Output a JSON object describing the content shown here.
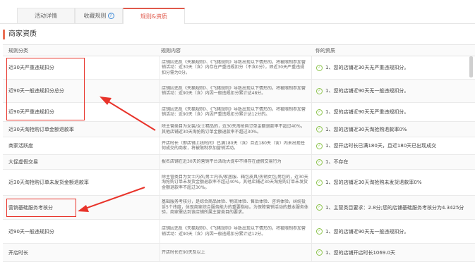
{
  "tabs": [
    {
      "label": "活动详情",
      "active": false
    },
    {
      "label": "收藏规则",
      "active": false,
      "has_help_icon": true
    },
    {
      "label": "规则&资质",
      "active": true
    }
  ],
  "section_title": "商家资质",
  "table": {
    "headers": [
      "规则分类",
      "规则内容",
      "你的资质"
    ],
    "rows": [
      {
        "category": "近30天严重违规扣分",
        "content": "店铺因违反《天猫规则》、《飞猪规则》导致出现以下情形的，将被限制参加营销活动：近30天（含）内存在严重违规扣分（不含0分），即近30天严重违规扣分需为0分。",
        "status": "1、您的店铺近30天无严重违规扣分。"
      },
      {
        "category": "近90天一般违规扣分总分",
        "content": "店铺因违反《天猫规则》、《飞猪规则》导致出现以下情形的，将被限制参加营销活动：近90天（含）内因一般违规扣分累计达48分。",
        "status": "1、您的店铺近90天无一般违规扣分。"
      },
      {
        "category": "近90天严重违规扣分",
        "content": "店铺因违反《天猫规则》、《飞猪规则》导致出现以下情形的，将被限制参加营销活动：近90天（含）内因严重违规扣分累计达12分的。",
        "status": "1、您的店铺近90天无严重违规扣分。"
      },
      {
        "category": "近30天淘抢购订单金额退款率",
        "content": "除主营类目为女装/女士精品的，近30天淘抢购订单金额退款率不超过40%，其他店铺近30天淘抢购订单金额退款率不超过30%。",
        "status": "1、您的店铺近30天淘抢购退款率0%"
      },
      {
        "category": "商家活跃度",
        "content": "开店时长（即店铺上线时间）已满180天（含）且近180天（含）内未出现任何成交的商家，将被限制参加营销活动。",
        "status": "1、您开店时长已满180天，且近180天已出现成交"
      },
      {
        "category": "大促虚假交易",
        "content": "报名店铺在近30天的营销平台活动大促中不得存在虚假交易行为",
        "status": "1、不存在"
      },
      {
        "category": "近30天淘抢购订单未发货金额退款率",
        "content": "除主营类目为女士内衣/男士内衣/家居服、箱包皮具/热销女包/男包的，近30天淘抢购订单未发货金额退款率不超过40%，其他店铺近30天淘抢购订单未发货金额退款率不超过30%。",
        "status": "1、您的店铺近30天淘抢购未发货退款率0%"
      },
      {
        "category": "营销基础服务考核分",
        "content": "基础服务考核分，是综合商品体验、物流体验、售后体验、咨询体验，纠纷投诉5个纬度，体现商家综合服务能力的重要指标。为保障营销活动的基本服务体验，商家需达到该店铺所属主营类目的要求。",
        "status": "1、主营类目要求：2.8分;您的店铺基础服务考核分为4.3425分"
      },
      {
        "category": "近90天一般违规扣分",
        "content": "店铺因违反《天猫规则》、《飞猪规则》导致出现以下情形的，将被限制参加营销活动：近90天（含）内因一般违规扣分累计达12分。",
        "status": "1、您的店铺近90天无一般违规扣分。"
      },
      {
        "category": "开店时长",
        "content": "开店时长在90天及以上",
        "status": "1、您的店铺开店时长1069.0天"
      }
    ]
  },
  "annotation_color": "#e8332a"
}
